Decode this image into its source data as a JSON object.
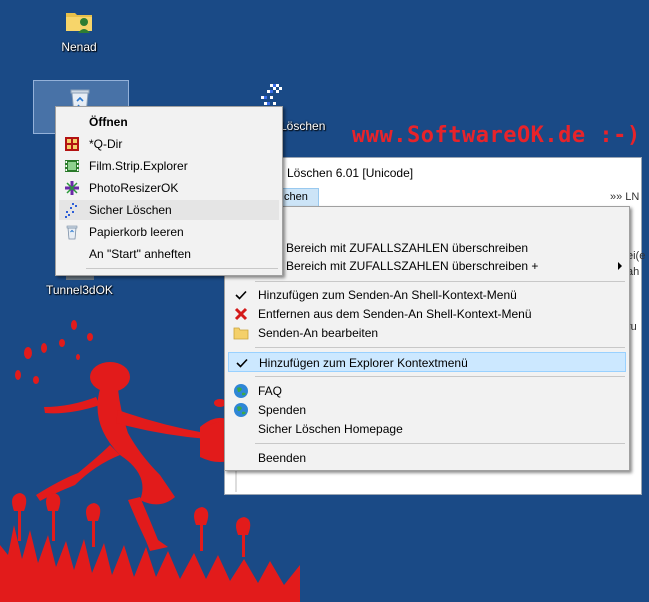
{
  "desktop": {
    "icons": [
      {
        "label": "Nenad"
      },
      {
        "label": ""
      },
      {
        "label": "Löschen"
      },
      {
        "label": "Tunnel3dOK"
      }
    ],
    "watermark": "www.SoftwareOK.de :-)"
  },
  "app_window": {
    "title": "Löschen 6.01 [Unicode]",
    "tab_label": "chen",
    "lng_label": "»» LN",
    "right_stubs": [
      "ei(e",
      "ah",
      "ru"
    ]
  },
  "recycle_menu": {
    "items": [
      {
        "label": "Öffnen",
        "icon": "none",
        "bold": true
      },
      {
        "label": "*Q-Dir",
        "icon": "qdir-icon"
      },
      {
        "label": "Film.Strip.Explorer",
        "icon": "filmstrip-icon"
      },
      {
        "label": "PhotoResizerOK",
        "icon": "photoresizer-icon"
      },
      {
        "label": "Sicher Löschen",
        "icon": "sicher-loeschen-icon"
      },
      {
        "label": "Papierkorb leeren",
        "icon": "recycle-bin-icon"
      },
      {
        "label": "An \"Start\" anheften",
        "icon": "none"
      }
    ]
  },
  "app_menu": {
    "items": [
      {
        "label": "Bereich mit ZUFALLSZAHLEN überschreiben"
      },
      {
        "label": "Bereich mit ZUFALLSZAHLEN überschreiben +"
      },
      {
        "label": "Hinzufügen zum Senden-An Shell-Kontext-Menü"
      },
      {
        "label": "Entfernen aus dem Senden-An Shell-Kontext-Menü"
      },
      {
        "label": "Senden-An bearbeiten"
      },
      {
        "label": "Hinzufügen zum Explorer Kontextmenü"
      },
      {
        "label": "FAQ"
      },
      {
        "label": "Spenden"
      },
      {
        "label": "Sicher Löschen Homepage"
      },
      {
        "label": "Beenden"
      }
    ]
  },
  "colors": {
    "desktop_bg": "#1a4a86",
    "watermark": "#e8232a",
    "menu_bg": "#f2f2f2",
    "selected": "#cce8ff"
  }
}
